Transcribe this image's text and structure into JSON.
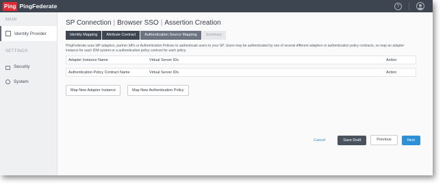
{
  "brand": {
    "logo": "Ping",
    "product": "PingFederate"
  },
  "topbar": {
    "help_icon": "?",
    "user_icon": "user-icon"
  },
  "sidebar": {
    "section_main": "MAIN",
    "section_settings": "SETTINGS",
    "items": [
      {
        "label": "Identity Provider",
        "icon": "idp-icon"
      },
      {
        "label": "Security",
        "icon": "lock-icon"
      },
      {
        "label": "System",
        "icon": "gear-icon"
      }
    ]
  },
  "breadcrumb": [
    "SP Connection",
    "Browser SSO",
    "Assertion Creation"
  ],
  "tabs": [
    {
      "label": "Identity Mapping",
      "state": "done"
    },
    {
      "label": "Attribute Contract",
      "state": "done"
    },
    {
      "label": "Authentication Source Mapping",
      "state": "current"
    },
    {
      "label": "Summary",
      "state": "inactive"
    }
  ],
  "description": "PingFederate uses IdP adapters, partner IdPs or Authentication Policies to authenticate users to your SP. Users may be authenticated by one of several different adapters or authentication policy contracts, so map an adapter instance for each IDM system or a authentication policy contract for each policy.",
  "tables": [
    {
      "col1": "Adapter Instance Name",
      "col2": "Virtual Server IDs",
      "col3": "Action"
    },
    {
      "col1": "Authentication Policy Contract Name",
      "col2": "Virtual Server IDs",
      "col3": "Action"
    }
  ],
  "buttons": {
    "map_adapter": "Map New Adapter Instance",
    "map_policy": "Map New Authentication Policy",
    "cancel": "Cancel",
    "save_draft": "Save Draft",
    "previous": "Previous",
    "next": "Next"
  }
}
